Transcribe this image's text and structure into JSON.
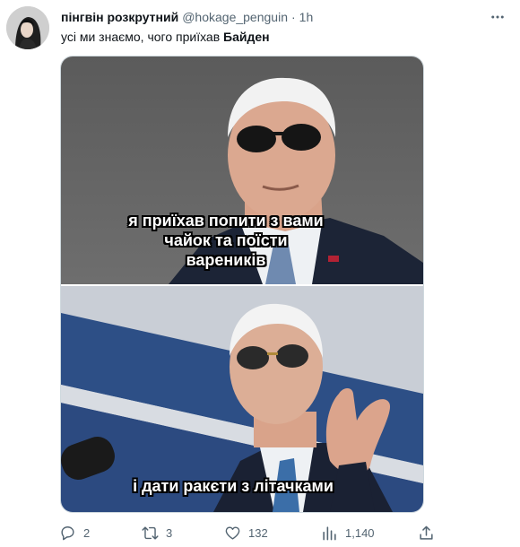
{
  "user": {
    "display_name": "пінгвін розкрутний",
    "handle": "@hokage_penguin",
    "separator": "·",
    "time": "1h"
  },
  "tweet": {
    "text_prefix": "усі ми знаємо, чого приїхав ",
    "text_bold": "Байден"
  },
  "media": {
    "top_caption_lines": [
      "я приїхав попити з вами",
      "чайок та поїсти",
      "вареників"
    ],
    "bottom_caption": "і дати ракєти з літачками"
  },
  "actions": {
    "replies": "2",
    "retweets": "3",
    "likes": "132",
    "views": "1,140"
  },
  "icons": {
    "more": "more-horizontal-icon",
    "reply": "reply-icon",
    "retweet": "retweet-icon",
    "like": "heart-icon",
    "views": "views-chart-icon",
    "share": "share-icon"
  },
  "colors": {
    "text_primary": "#0f1419",
    "text_secondary": "#536471",
    "border": "#cfd9de"
  }
}
